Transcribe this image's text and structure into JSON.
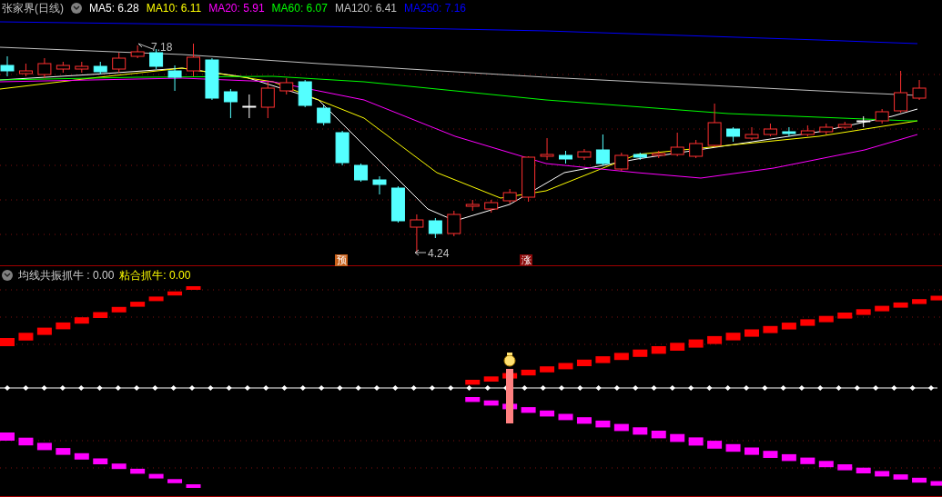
{
  "header": {
    "title": "张家界(日线)",
    "indicators": [
      {
        "label": "MA5: 6.28",
        "color": "#ffffff"
      },
      {
        "label": "MA10: 6.11",
        "color": "#ffff00"
      },
      {
        "label": "MA20: 5.91",
        "color": "#ff00ff"
      },
      {
        "label": "MA60: 6.07",
        "color": "#00ff00"
      },
      {
        "label": "MA120: 6.41",
        "color": "#c0c0c0"
      },
      {
        "label": "MA250: 7.16",
        "color": "#0000ff"
      }
    ]
  },
  "price_chart": {
    "high_label": "7.18",
    "low_label": "4.24",
    "signals": [
      {
        "text": "预",
        "color": "#c8601a"
      },
      {
        "text": "涨",
        "color": "#8b0a0a"
      }
    ]
  },
  "indicator_panel": {
    "values": [
      {
        "label": "均线共振抓牛 : 0.00",
        "color": "#d0d0d0"
      },
      {
        "label": "粘合抓牛: 0.00",
        "color": "#ffff00"
      }
    ]
  }
}
